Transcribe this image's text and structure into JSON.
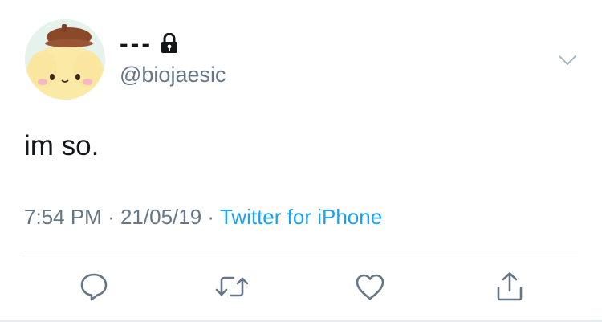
{
  "user": {
    "display_name": "---",
    "handle": "@biojaesic",
    "protected_icon": "lock-icon",
    "avatar": "avatar-image"
  },
  "tweet": {
    "text": "im so.",
    "time": "7:54 PM",
    "date": "21/05/19",
    "separator": "·",
    "source": "Twitter for iPhone"
  },
  "icons": {
    "menu": "chevron-down-icon",
    "reply": "reply-icon",
    "retweet": "retweet-icon",
    "like": "heart-icon",
    "share": "share-icon"
  },
  "colors": {
    "text": "#14171a",
    "secondary": "#657786",
    "link": "#1da1f2",
    "divider": "#e1e8ed"
  }
}
